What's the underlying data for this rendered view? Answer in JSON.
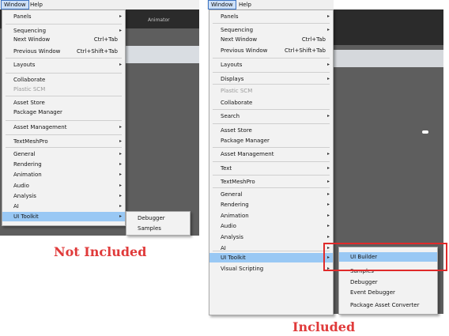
{
  "left": {
    "menubar": [
      "Window",
      "Help"
    ],
    "items": [
      {
        "label": "Panels",
        "arrow": true
      },
      {
        "label": "Sequencing",
        "arrow": true
      },
      {
        "label": "Next Window",
        "shortcut": "Ctrl+Tab"
      },
      {
        "label": "Previous Window",
        "shortcut": "Ctrl+Shift+Tab"
      },
      {
        "label": "Layouts",
        "arrow": true
      },
      {
        "label": "Collaborate"
      },
      {
        "label": "Plastic SCM",
        "dim": true
      },
      {
        "label": "Asset Store"
      },
      {
        "label": "Package Manager"
      },
      {
        "label": "Asset Management",
        "arrow": true
      },
      {
        "label": "TextMeshPro",
        "arrow": true
      },
      {
        "label": "General",
        "arrow": true
      },
      {
        "label": "Rendering",
        "arrow": true
      },
      {
        "label": "Animation",
        "arrow": true
      },
      {
        "label": "Audio",
        "arrow": true
      },
      {
        "label": "Analysis",
        "arrow": true
      },
      {
        "label": "AI",
        "arrow": true
      },
      {
        "label": "UI Toolkit",
        "arrow": true,
        "highlight": true
      }
    ],
    "submenu": [
      "Debugger",
      "Samples"
    ],
    "editor_tab": "Animator",
    "caption": "Not Included"
  },
  "right": {
    "menubar": [
      "Window",
      "Help"
    ],
    "items": [
      {
        "label": "Panels",
        "arrow": true
      },
      {
        "label": "Sequencing",
        "arrow": true
      },
      {
        "label": "Next Window",
        "shortcut": "Ctrl+Tab"
      },
      {
        "label": "Previous Window",
        "shortcut": "Ctrl+Shift+Tab"
      },
      {
        "label": "Layouts",
        "arrow": true
      },
      {
        "label": "Displays",
        "arrow": true
      },
      {
        "label": "Plastic SCM",
        "dim": true
      },
      {
        "label": "Collaborate"
      },
      {
        "label": "Search",
        "arrow": true
      },
      {
        "label": "Asset Store"
      },
      {
        "label": "Package Manager"
      },
      {
        "label": "Asset Management",
        "arrow": true
      },
      {
        "label": "Text",
        "arrow": true
      },
      {
        "label": "TextMeshPro",
        "arrow": true
      },
      {
        "label": "General",
        "arrow": true
      },
      {
        "label": "Rendering",
        "arrow": true
      },
      {
        "label": "Animation",
        "arrow": true
      },
      {
        "label": "Audio",
        "arrow": true
      },
      {
        "label": "Analysis",
        "arrow": true
      },
      {
        "label": "AI",
        "arrow": true
      },
      {
        "label": "UI Toolkit",
        "arrow": true,
        "highlight": true
      },
      {
        "label": "Visual Scripting",
        "arrow": true
      }
    ],
    "submenu": [
      "UI Builder",
      "Samples",
      "Debugger",
      "Event Debugger",
      "Package Asset Converter"
    ],
    "caption": "Included"
  },
  "colors": {
    "caption": "#e03a3a",
    "highlight": "#99c8f4",
    "callout": "#e02a2a",
    "editor": "#5e5e5e"
  },
  "icons": {
    "arrow": "chevron-right-icon"
  }
}
